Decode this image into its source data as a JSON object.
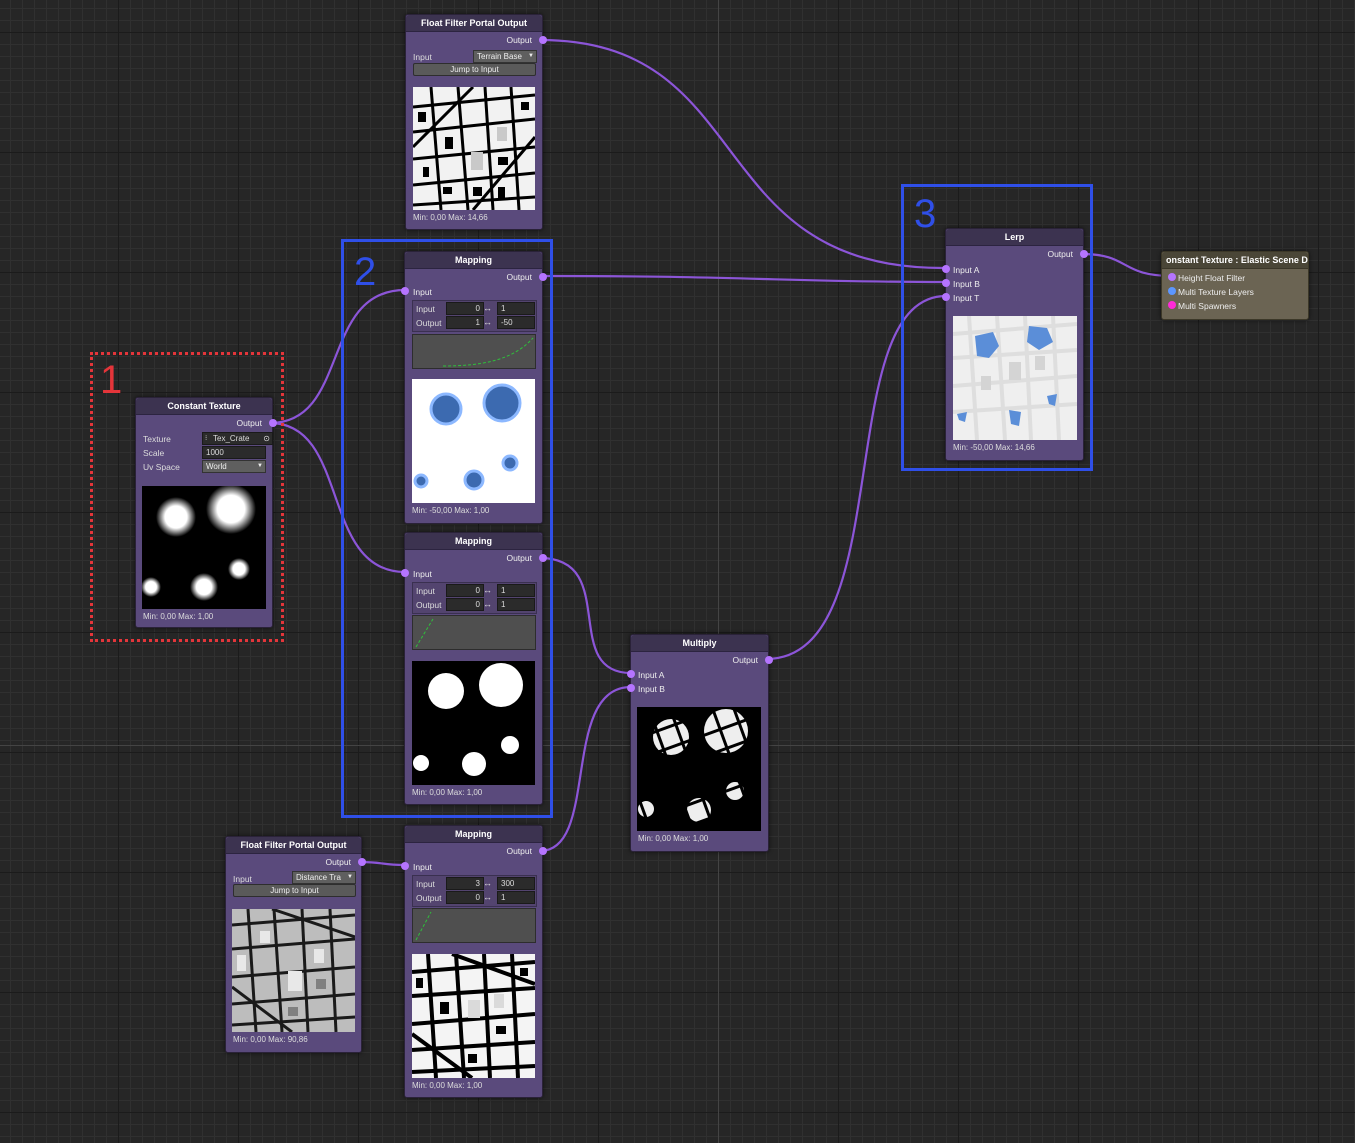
{
  "colors": {
    "background": "#262626",
    "node_body": "#5a4a7c",
    "node_header": "#3c3350",
    "port": "#b574ff",
    "wire": "#8c55d8",
    "annotation_red": "#e4353a",
    "annotation_blue": "#2f4fe8",
    "port_blue": "#5c96ff",
    "port_magenta": "#ff2ad8",
    "preview_blue": "#5b8ed8",
    "curve_green": "#2fbf3c"
  },
  "annotations": {
    "one": "1",
    "two": "2",
    "three": "3"
  },
  "nodes": {
    "ffp_top": {
      "title": "Float Filter Portal Output",
      "output": "Output",
      "input_label": "Input",
      "input_value": "Terrain Base",
      "jump_button": "Jump to Input",
      "minmax": "Min: 0,00 Max: 14,66"
    },
    "mapping1": {
      "title": "Mapping",
      "output": "Output",
      "input_port": "Input",
      "row1_label": "Input",
      "row1_from": "0",
      "row1_to": "1",
      "row2_label": "Output",
      "row2_from": "1",
      "row2_to": "-50",
      "arrow": "↔",
      "minmax": "Min: -50,00 Max: 1,00"
    },
    "mapping2": {
      "title": "Mapping",
      "output": "Output",
      "input_port": "Input",
      "row1_label": "Input",
      "row1_from": "0",
      "row1_to": "1",
      "row2_label": "Output",
      "row2_from": "0",
      "row2_to": "1",
      "arrow": "↔",
      "minmax": "Min: 0,00 Max: 1,00"
    },
    "mapping3": {
      "title": "Mapping",
      "output": "Output",
      "input_port": "Input",
      "row1_label": "Input",
      "row1_from": "3",
      "row1_to": "300",
      "row2_label": "Output",
      "row2_from": "0",
      "row2_to": "1",
      "arrow": "↔",
      "minmax": "Min: 0,00 Max: 1,00"
    },
    "constant": {
      "title": "Constant Texture",
      "output": "Output",
      "texture_label": "Texture",
      "texture_value": "Tex_Crate",
      "scale_label": "Scale",
      "scale_value": "1000",
      "uv_label": "Uv Space",
      "uv_value": "World",
      "minmax": "Min: 0,00 Max: 1,00"
    },
    "ffp_bottom": {
      "title": "Float Filter Portal Output",
      "output": "Output",
      "input_label": "Input",
      "input_value": "Distance Tra",
      "jump_button": "Jump to Input",
      "minmax": "Min: 0,00 Max: 90,86"
    },
    "multiply": {
      "title": "Multiply",
      "output": "Output",
      "input_a": "Input A",
      "input_b": "Input B",
      "minmax": "Min: 0,00 Max: 1,00"
    },
    "lerp": {
      "title": "Lerp",
      "output": "Output",
      "input_a": "Input A",
      "input_b": "Input B",
      "input_t": "Input T",
      "minmax": "Min: -50,00 Max: 14,66"
    },
    "scene_def": {
      "title": "onstant Texture : Elastic Scene Def",
      "port1": "Height Float Filter",
      "port2": "Multi Texture Layers",
      "port3": "Multi Spawners"
    }
  }
}
